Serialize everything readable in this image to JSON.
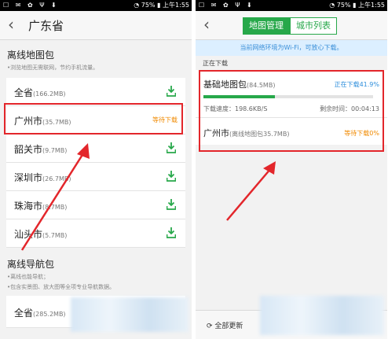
{
  "status_bar": {
    "battery": "75%",
    "time": "上午1:55"
  },
  "left": {
    "title": "广东省",
    "offline_map": {
      "heading": "离线地图包",
      "desc": "•浏览地图无需联网，节约手机流量。",
      "items": [
        {
          "name": "全省",
          "size": "(166.2MB)",
          "state": "download"
        },
        {
          "name": "广州市",
          "size": "(35.7MB)",
          "state": "等待下载"
        },
        {
          "name": "韶关市",
          "size": "(9.7MB)",
          "state": "download"
        },
        {
          "name": "深圳市",
          "size": "(26.7MB)",
          "state": "download"
        },
        {
          "name": "珠海市",
          "size": "(8.7MB)",
          "state": "download"
        },
        {
          "name": "汕头市",
          "size": "(5.7MB)",
          "state": "download"
        }
      ]
    },
    "nav_pack": {
      "heading": "离线导航包",
      "desc1": "•离线也能导航；",
      "desc2": "•包含实景图、放大图等全项专业导航数据。",
      "items": [
        {
          "name": "全省",
          "size": "(285.2MB)"
        }
      ]
    }
  },
  "right": {
    "tabs": [
      "地图管理",
      "城市列表"
    ],
    "notice": "当前网络环境为Wi-Fi，可放心下载。",
    "downloading_label": "正在下载",
    "base_pack": {
      "name": "基础地图包",
      "size": "(84.5MB)",
      "status": "正在下载41.9%",
      "progress": 0.419,
      "speed": "下载速度：198.6KB/S",
      "remaining": "剩余时间：00:04:13"
    },
    "city_pack": {
      "name": "广州市",
      "detail": "(离线地图包35.7MB)",
      "status": "等待下载0%"
    },
    "footer": {
      "refresh_label": "全部更新"
    }
  },
  "colors": {
    "green": "#27a84a",
    "orange": "#f08a00",
    "blue": "#2f8fdc",
    "red": "#e3262b"
  }
}
